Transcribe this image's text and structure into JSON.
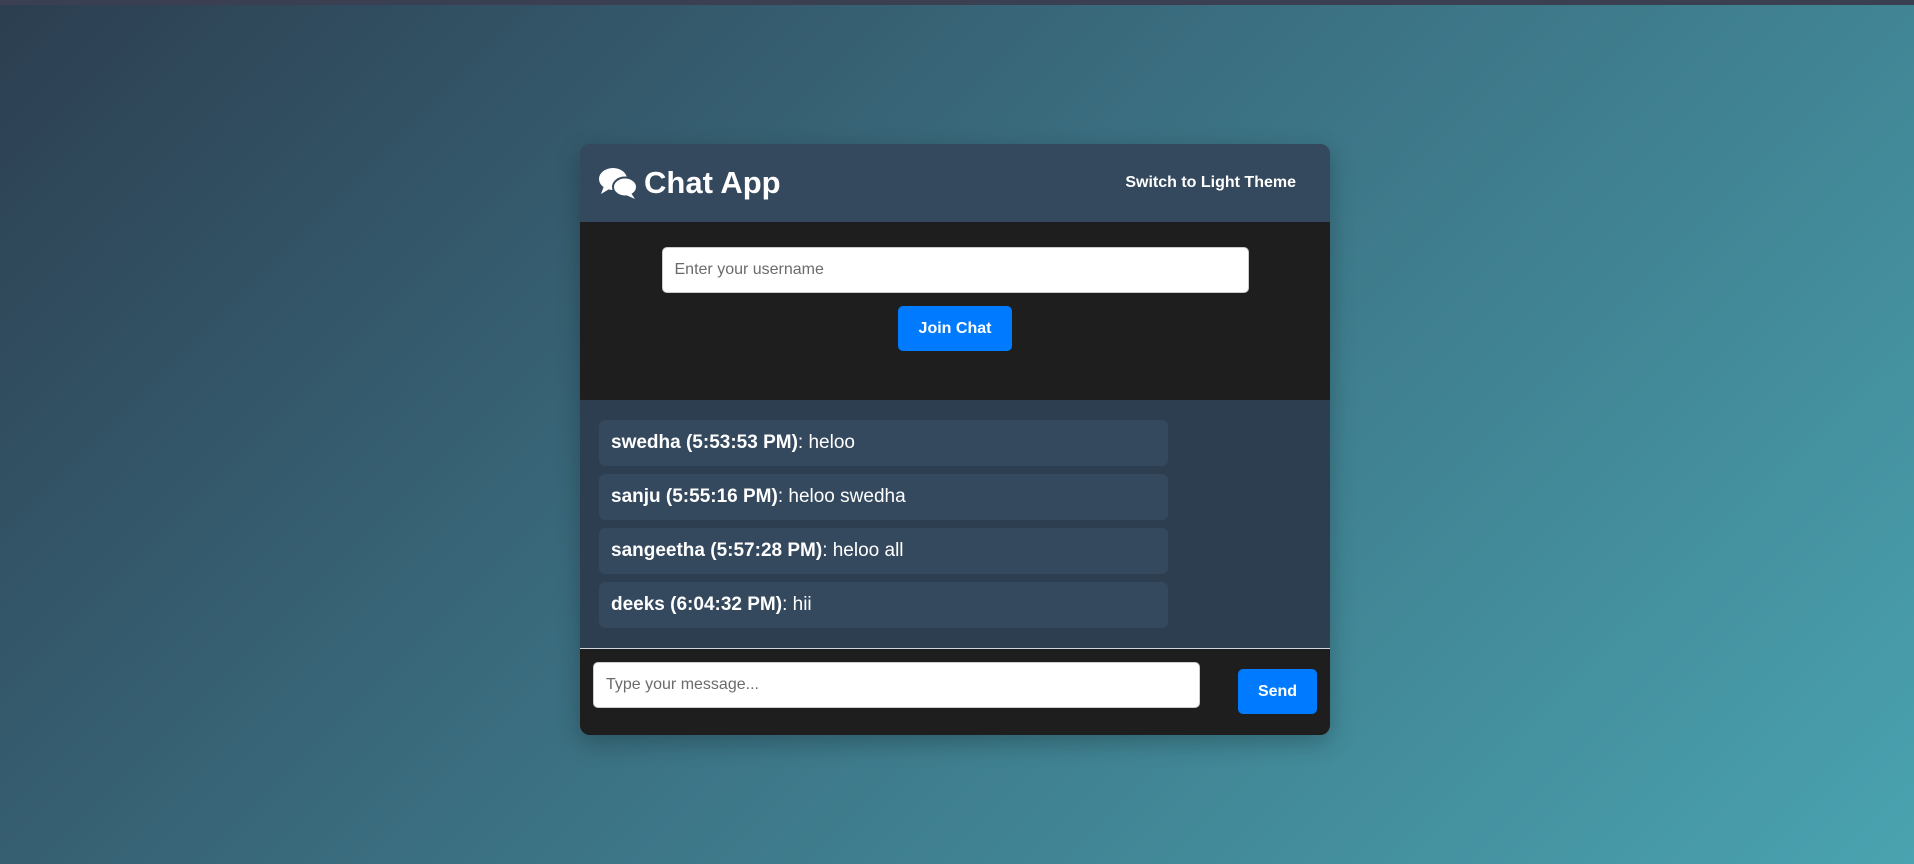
{
  "header": {
    "title": "Chat App",
    "theme_toggle_label": "Switch to Light Theme",
    "icon": "chat-bubbles-icon"
  },
  "join": {
    "username_placeholder": "Enter your username",
    "username_value": "",
    "join_label": "Join Chat"
  },
  "messages": [
    {
      "user": "swedha (5:53:53 PM)",
      "text": ": heloo"
    },
    {
      "user": "sanju (5:55:16 PM)",
      "text": ": heloo swedha"
    },
    {
      "user": "sangeetha (5:57:28 PM)",
      "text": ": heloo all"
    },
    {
      "user": "deeks (6:04:32 PM)",
      "text": ": hii"
    }
  ],
  "composer": {
    "message_placeholder": "Type your message...",
    "message_value": "",
    "send_label": "Send"
  },
  "colors": {
    "accent": "#007bff",
    "header_bg": "#34495e",
    "panel_dark": "#1e1e1e",
    "message_bg": "#34495e"
  }
}
